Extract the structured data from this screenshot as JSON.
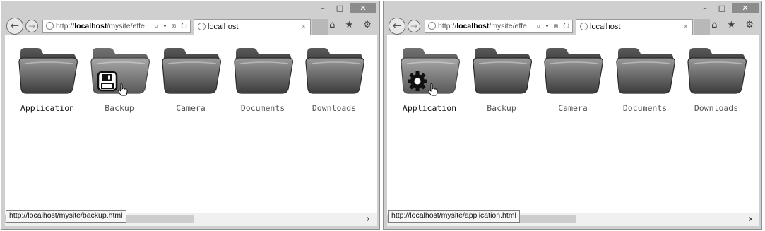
{
  "left_window": {
    "title_buttons": {
      "minimize": "–",
      "maximize": "□",
      "close": "✕"
    },
    "nav": {
      "back": "←",
      "forward": "→"
    },
    "address": {
      "prefix": "http://",
      "host": "localhost",
      "path": "/mysite/effe",
      "tools": "⌕ ▾ ⊠ ↻"
    },
    "tab": {
      "label": "localhost",
      "close": "×"
    },
    "toolbar_icons": "⌂ ★ ⚙",
    "folders": [
      {
        "label": "Application"
      },
      {
        "label": "Backup"
      },
      {
        "label": "Camera"
      },
      {
        "label": "Documents"
      },
      {
        "label": "Downloads"
      }
    ],
    "hover_icon": "floppy-disk-icon",
    "status_text": "http://localhost/mysite/backup.html",
    "scroll_arrow": "›"
  },
  "right_window": {
    "title_buttons": {
      "minimize": "–",
      "maximize": "□",
      "close": "✕"
    },
    "nav": {
      "back": "←",
      "forward": "→"
    },
    "address": {
      "prefix": "http://",
      "host": "localhost",
      "path": "/mysite/effe",
      "tools": "⌕ ▾ ⊠ ↻"
    },
    "tab": {
      "label": "localhost",
      "close": "×"
    },
    "toolbar_icons": "⌂ ★ ⚙",
    "folders": [
      {
        "label": "Application"
      },
      {
        "label": "Backup"
      },
      {
        "label": "Camera"
      },
      {
        "label": "Documents"
      },
      {
        "label": "Downloads"
      }
    ],
    "hover_icon": "gear-icon",
    "status_text": "http://localhost/mysite/application.html",
    "scroll_arrow": "›"
  },
  "colors": {
    "folder_dark": "#4a4a4a",
    "folder_light": "#8a8a8a",
    "chrome": "#cfcfcf"
  }
}
